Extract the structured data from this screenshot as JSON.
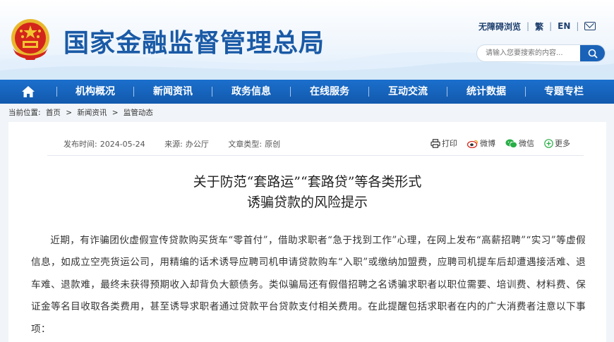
{
  "header": {
    "site_title": "国家金融监督管理总局",
    "links": [
      "无障碍浏览",
      "繁",
      "EN"
    ],
    "mail_icon": "mail-icon",
    "search_placeholder": "请输入您要搜索的内容...",
    "search_icon": "search-icon"
  },
  "nav": {
    "home_icon": "home-icon",
    "items": [
      "机构概况",
      "新闻资讯",
      "政务信息",
      "在线服务",
      "互动交流",
      "统计数据",
      "专题专栏"
    ]
  },
  "breadcrumb": {
    "label": "当前位置:",
    "items": [
      "首页",
      ">",
      "新闻资讯",
      ">",
      "监管动态"
    ]
  },
  "article": {
    "publish_label": "发布时间:",
    "publish_date": "2024-05-24",
    "source_label": "来源:",
    "source": "办公厅",
    "type_label": "文章类型:",
    "type": "原创",
    "share": {
      "print": "打印",
      "weibo": "微博",
      "wechat": "微信",
      "more": "更多"
    },
    "title_line1": "关于防范“套路运”“套路贷”等各类形式",
    "title_line2": "诱骗贷款的风险提示",
    "paragraph": "近期，有诈骗团伙虚假宣传贷款购买货车“零首付”，借助求职者“急于找到工作”心理，在网上发布“高薪招聘”“实习”等虚假信息，如成立空壳货运公司，用精编的话术诱导应聘司机申请贷款购车“入职”或缴纳加盟费，应聘司机提车后却遭遇接活难、退车难、退款难，最终未获得预期收入却背负大额债务。类似骗局还有假借招聘之名诱骗求职者以职位需要、培训费、材料费、保证金等名目收取各类费用，甚至诱导求职者通过贷款平台贷款支付相关费用。在此提醒包括求职者在内的广大消费者注意以下事项："
  },
  "colors": {
    "brand_blue": "#1a5aa6",
    "nav_blue": "#1565c0",
    "emblem_red": "#d4251c",
    "emblem_gold": "#f3c331"
  }
}
